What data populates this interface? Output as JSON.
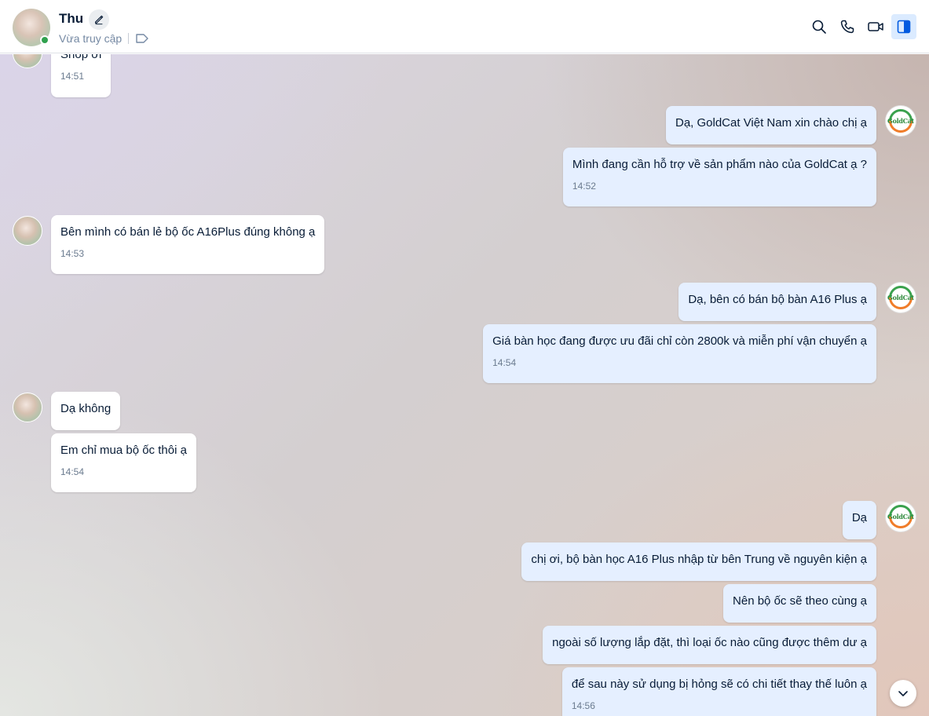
{
  "header": {
    "name": "Thu",
    "status": "Vừa truy cập",
    "icons": [
      "search-icon",
      "phone-icon",
      "video-icon",
      "sidebar-toggle-icon"
    ]
  },
  "shop_logo_text": "GoldCat",
  "messages": [
    {
      "side": "in",
      "text": "Shop ơi",
      "time": "14:51"
    },
    {
      "side": "out",
      "text": "Dạ, GoldCat Việt Nam xin chào chị ạ"
    },
    {
      "side": "out",
      "text": "Mình đang cần hỗ trợ về sản phẩm nào của GoldCat ạ ?",
      "time": "14:52"
    },
    {
      "side": "in",
      "text": "Bên mình có bán lẻ bộ ốc A16Plus đúng không ạ",
      "time": "14:53"
    },
    {
      "side": "out",
      "text": "Dạ, bên có bán bộ bàn A16 Plus ạ"
    },
    {
      "side": "out",
      "text": "Giá bàn học đang được ưu đãi chỉ còn 2800k và miễn phí vận chuyển ạ",
      "time": "14:54"
    },
    {
      "side": "in",
      "text": "Dạ không"
    },
    {
      "side": "in",
      "text": "Em chỉ mua bộ ốc thôi ạ",
      "time": "14:54"
    },
    {
      "side": "out",
      "text": "Dạ"
    },
    {
      "side": "out",
      "text": "chị ơi, bộ bàn học A16 Plus nhập từ bên Trung về nguyên kiện ạ"
    },
    {
      "side": "out",
      "text": "Nên bộ ốc sẽ theo cùng ạ"
    },
    {
      "side": "out",
      "text": "ngoài số lượng lắp đặt, thì loại ốc nào cũng được thêm dư ạ"
    },
    {
      "side": "out",
      "text": "để sau này sử dụng bị hỏng sẽ có  chi tiết thay thế luôn ạ",
      "time": "14:56"
    }
  ]
}
